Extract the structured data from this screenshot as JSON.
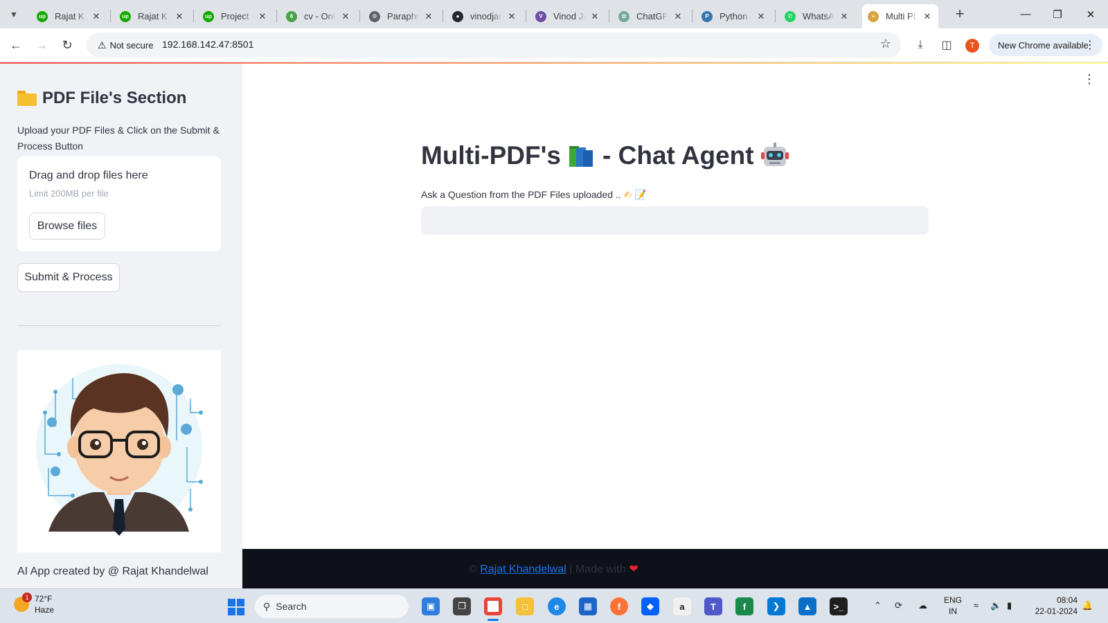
{
  "browser": {
    "tabs": [
      {
        "label": "Rajat K...",
        "favicon": "upwork-icon",
        "color": "#14a800",
        "glyph": "up"
      },
      {
        "label": "Rajat K...",
        "favicon": "upwork-icon",
        "color": "#14a800",
        "glyph": "up"
      },
      {
        "label": "Project C",
        "favicon": "upwork-icon",
        "color": "#14a800",
        "glyph": "up"
      },
      {
        "label": "cv - Onli",
        "favicon": "leaf-icon",
        "color": "#47a248",
        "glyph": "6"
      },
      {
        "label": "Paraphra",
        "favicon": "robot-icon",
        "color": "#5f6368",
        "glyph": "⚙"
      },
      {
        "label": "vinodjan",
        "favicon": "github-icon",
        "color": "#24292f",
        "glyph": "●"
      },
      {
        "label": "Vinod Ja",
        "favicon": "user-icon",
        "color": "#6d4ca6",
        "glyph": "V"
      },
      {
        "label": "ChatGPT",
        "favicon": "openai-icon",
        "color": "#74aa9c",
        "glyph": "✿"
      },
      {
        "label": "Python F",
        "favicon": "python-icon",
        "color": "#3776ab",
        "glyph": "P"
      },
      {
        "label": "WhatsAp",
        "favicon": "whatsapp-icon",
        "color": "#25d366",
        "glyph": "✆"
      },
      {
        "label": "Multi PD",
        "favicon": "scroll-icon",
        "color": "#d9a441",
        "glyph": "≡",
        "active": true
      }
    ],
    "security_label": "Not secure",
    "url": "192.168.142.47:8501",
    "profile_initial": "T",
    "update_label": "New Chrome available"
  },
  "sidebar": {
    "title": "PDF File's Section",
    "description": "Upload your PDF Files & Click on the Submit & Process Button",
    "dropzone_title": "Drag and drop files here",
    "dropzone_limit": "Limit 200MB per file",
    "browse_label": "Browse files",
    "submit_label": "Submit & Process",
    "credit": "AI App created by @ Rajat Khandelwal"
  },
  "main": {
    "title_part1": "Multi-PDF's",
    "title_part2": "- Chat Agent",
    "question_label": "Ask a Question from the PDF Files uploaded ..",
    "question_value": ""
  },
  "footer": {
    "prefix": "©",
    "link_text": "Rajat Khandelwal",
    "suffix": "| Made with"
  },
  "taskbar": {
    "weather_temp": "72°F",
    "weather_desc": "Haze",
    "weather_badge": "1",
    "search_label": "Search",
    "lang_line1": "ENG",
    "lang_line2": "IN",
    "time": "08:04",
    "date": "22-01-2024"
  },
  "colors": {
    "accent": "#ff4b4b",
    "sidebar_bg": "#f0f2f6",
    "footer_bg": "#0e1117",
    "link": "#1a73e8"
  }
}
